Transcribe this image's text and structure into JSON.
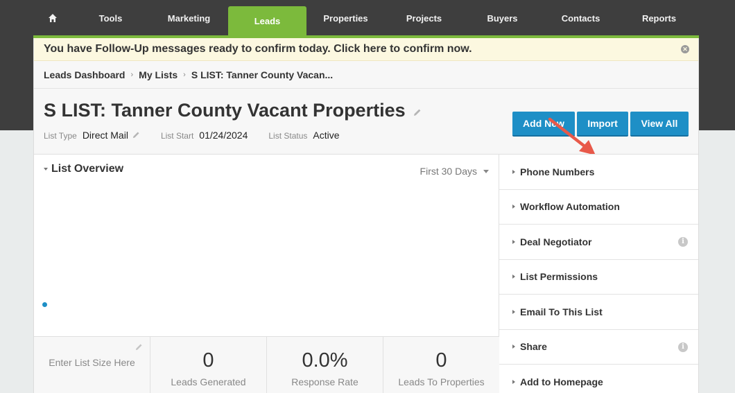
{
  "nav": {
    "items": [
      {
        "label": "Tools"
      },
      {
        "label": "Marketing"
      },
      {
        "label": "Leads"
      },
      {
        "label": "Properties"
      },
      {
        "label": "Projects"
      },
      {
        "label": "Buyers"
      },
      {
        "label": "Contacts"
      },
      {
        "label": "Reports"
      }
    ],
    "active": "Leads",
    "home_icon": "home-icon"
  },
  "alert": {
    "text": "You have Follow-Up messages ready to confirm today. Click here to confirm now.",
    "close_icon": "close-icon"
  },
  "breadcrumb": {
    "items": [
      "Leads Dashboard",
      "My Lists",
      "S LIST: Tanner County Vacan..."
    ],
    "separator": "›"
  },
  "header": {
    "title": "S LIST: Tanner County Vacant Properties",
    "buttons": {
      "add_new": "Add New",
      "import": "Import",
      "view_all": "View All"
    },
    "meta": {
      "list_type_label": "List Type",
      "list_type_value": "Direct Mail",
      "list_start_label": "List Start",
      "list_start_value": "01/24/2024",
      "list_status_label": "List Status",
      "list_status_value": "Active"
    }
  },
  "overview": {
    "title": "List Overview",
    "period": "First 30 Days"
  },
  "stats": {
    "list_size_placeholder": "Enter List Size Here",
    "items": [
      {
        "value": "0",
        "label": "Leads Generated"
      },
      {
        "value": "0.0%",
        "label": "Response Rate"
      },
      {
        "value": "0",
        "label": "Leads To Properties"
      }
    ]
  },
  "sidebar": {
    "items": [
      {
        "label": "Phone Numbers",
        "info": false
      },
      {
        "label": "Workflow Automation",
        "info": false
      },
      {
        "label": "Deal Negotiator",
        "info": true
      },
      {
        "label": "List Permissions",
        "info": false
      },
      {
        "label": "Email To This List",
        "info": false
      },
      {
        "label": "Share",
        "info": true
      },
      {
        "label": "Add to Homepage",
        "info": false
      }
    ]
  },
  "colors": {
    "nav_bg": "#3e3e3e",
    "accent_green": "#7cba3c",
    "button_blue": "#1e8fc6",
    "alert_bg": "#fcf8e0",
    "annotation_arrow": "#e8594a"
  }
}
